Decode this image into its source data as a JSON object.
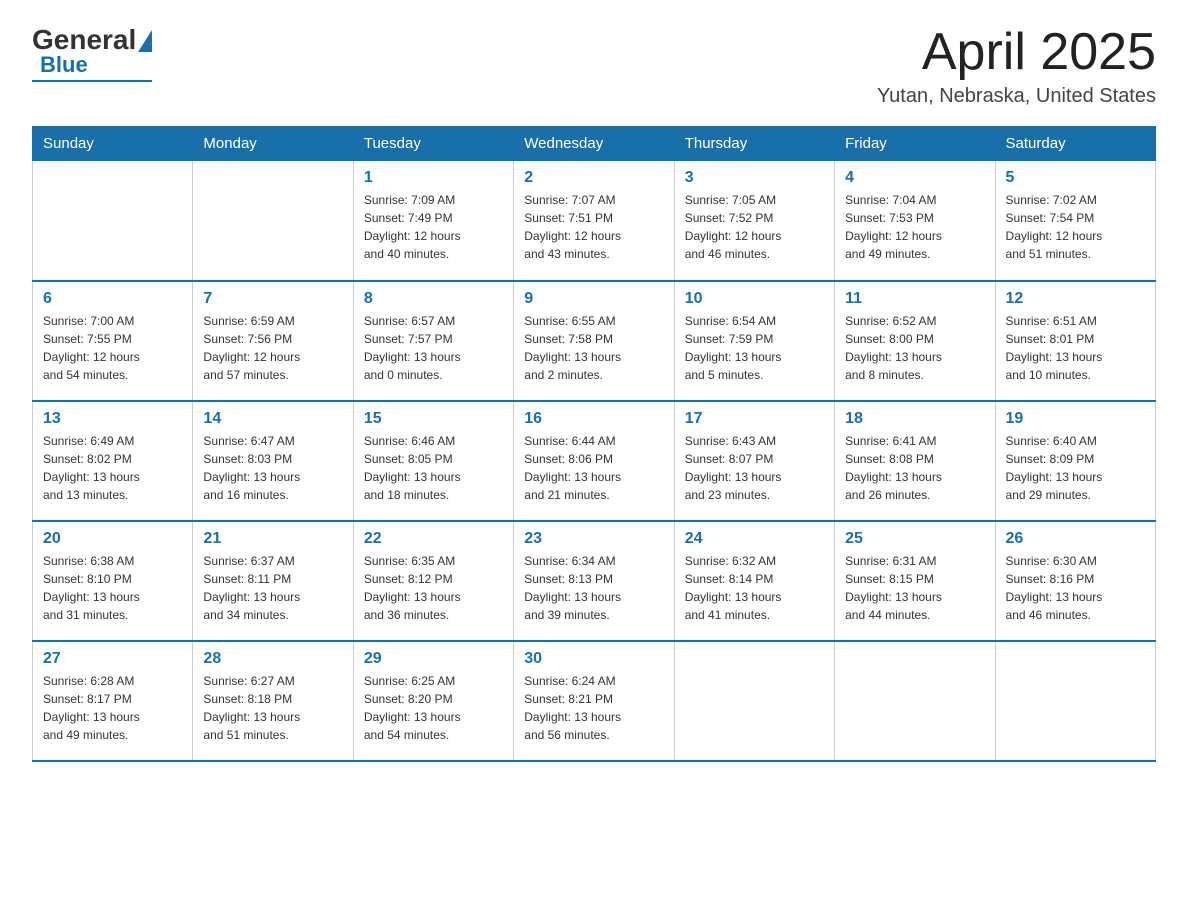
{
  "logo": {
    "general": "General",
    "blue": "Blue"
  },
  "header": {
    "month": "April 2025",
    "location": "Yutan, Nebraska, United States"
  },
  "days_of_week": [
    "Sunday",
    "Monday",
    "Tuesday",
    "Wednesday",
    "Thursday",
    "Friday",
    "Saturday"
  ],
  "weeks": [
    [
      {
        "day": "",
        "info": ""
      },
      {
        "day": "",
        "info": ""
      },
      {
        "day": "1",
        "info": "Sunrise: 7:09 AM\nSunset: 7:49 PM\nDaylight: 12 hours\nand 40 minutes."
      },
      {
        "day": "2",
        "info": "Sunrise: 7:07 AM\nSunset: 7:51 PM\nDaylight: 12 hours\nand 43 minutes."
      },
      {
        "day": "3",
        "info": "Sunrise: 7:05 AM\nSunset: 7:52 PM\nDaylight: 12 hours\nand 46 minutes."
      },
      {
        "day": "4",
        "info": "Sunrise: 7:04 AM\nSunset: 7:53 PM\nDaylight: 12 hours\nand 49 minutes."
      },
      {
        "day": "5",
        "info": "Sunrise: 7:02 AM\nSunset: 7:54 PM\nDaylight: 12 hours\nand 51 minutes."
      }
    ],
    [
      {
        "day": "6",
        "info": "Sunrise: 7:00 AM\nSunset: 7:55 PM\nDaylight: 12 hours\nand 54 minutes."
      },
      {
        "day": "7",
        "info": "Sunrise: 6:59 AM\nSunset: 7:56 PM\nDaylight: 12 hours\nand 57 minutes."
      },
      {
        "day": "8",
        "info": "Sunrise: 6:57 AM\nSunset: 7:57 PM\nDaylight: 13 hours\nand 0 minutes."
      },
      {
        "day": "9",
        "info": "Sunrise: 6:55 AM\nSunset: 7:58 PM\nDaylight: 13 hours\nand 2 minutes."
      },
      {
        "day": "10",
        "info": "Sunrise: 6:54 AM\nSunset: 7:59 PM\nDaylight: 13 hours\nand 5 minutes."
      },
      {
        "day": "11",
        "info": "Sunrise: 6:52 AM\nSunset: 8:00 PM\nDaylight: 13 hours\nand 8 minutes."
      },
      {
        "day": "12",
        "info": "Sunrise: 6:51 AM\nSunset: 8:01 PM\nDaylight: 13 hours\nand 10 minutes."
      }
    ],
    [
      {
        "day": "13",
        "info": "Sunrise: 6:49 AM\nSunset: 8:02 PM\nDaylight: 13 hours\nand 13 minutes."
      },
      {
        "day": "14",
        "info": "Sunrise: 6:47 AM\nSunset: 8:03 PM\nDaylight: 13 hours\nand 16 minutes."
      },
      {
        "day": "15",
        "info": "Sunrise: 6:46 AM\nSunset: 8:05 PM\nDaylight: 13 hours\nand 18 minutes."
      },
      {
        "day": "16",
        "info": "Sunrise: 6:44 AM\nSunset: 8:06 PM\nDaylight: 13 hours\nand 21 minutes."
      },
      {
        "day": "17",
        "info": "Sunrise: 6:43 AM\nSunset: 8:07 PM\nDaylight: 13 hours\nand 23 minutes."
      },
      {
        "day": "18",
        "info": "Sunrise: 6:41 AM\nSunset: 8:08 PM\nDaylight: 13 hours\nand 26 minutes."
      },
      {
        "day": "19",
        "info": "Sunrise: 6:40 AM\nSunset: 8:09 PM\nDaylight: 13 hours\nand 29 minutes."
      }
    ],
    [
      {
        "day": "20",
        "info": "Sunrise: 6:38 AM\nSunset: 8:10 PM\nDaylight: 13 hours\nand 31 minutes."
      },
      {
        "day": "21",
        "info": "Sunrise: 6:37 AM\nSunset: 8:11 PM\nDaylight: 13 hours\nand 34 minutes."
      },
      {
        "day": "22",
        "info": "Sunrise: 6:35 AM\nSunset: 8:12 PM\nDaylight: 13 hours\nand 36 minutes."
      },
      {
        "day": "23",
        "info": "Sunrise: 6:34 AM\nSunset: 8:13 PM\nDaylight: 13 hours\nand 39 minutes."
      },
      {
        "day": "24",
        "info": "Sunrise: 6:32 AM\nSunset: 8:14 PM\nDaylight: 13 hours\nand 41 minutes."
      },
      {
        "day": "25",
        "info": "Sunrise: 6:31 AM\nSunset: 8:15 PM\nDaylight: 13 hours\nand 44 minutes."
      },
      {
        "day": "26",
        "info": "Sunrise: 6:30 AM\nSunset: 8:16 PM\nDaylight: 13 hours\nand 46 minutes."
      }
    ],
    [
      {
        "day": "27",
        "info": "Sunrise: 6:28 AM\nSunset: 8:17 PM\nDaylight: 13 hours\nand 49 minutes."
      },
      {
        "day": "28",
        "info": "Sunrise: 6:27 AM\nSunset: 8:18 PM\nDaylight: 13 hours\nand 51 minutes."
      },
      {
        "day": "29",
        "info": "Sunrise: 6:25 AM\nSunset: 8:20 PM\nDaylight: 13 hours\nand 54 minutes."
      },
      {
        "day": "30",
        "info": "Sunrise: 6:24 AM\nSunset: 8:21 PM\nDaylight: 13 hours\nand 56 minutes."
      },
      {
        "day": "",
        "info": ""
      },
      {
        "day": "",
        "info": ""
      },
      {
        "day": "",
        "info": ""
      }
    ]
  ]
}
